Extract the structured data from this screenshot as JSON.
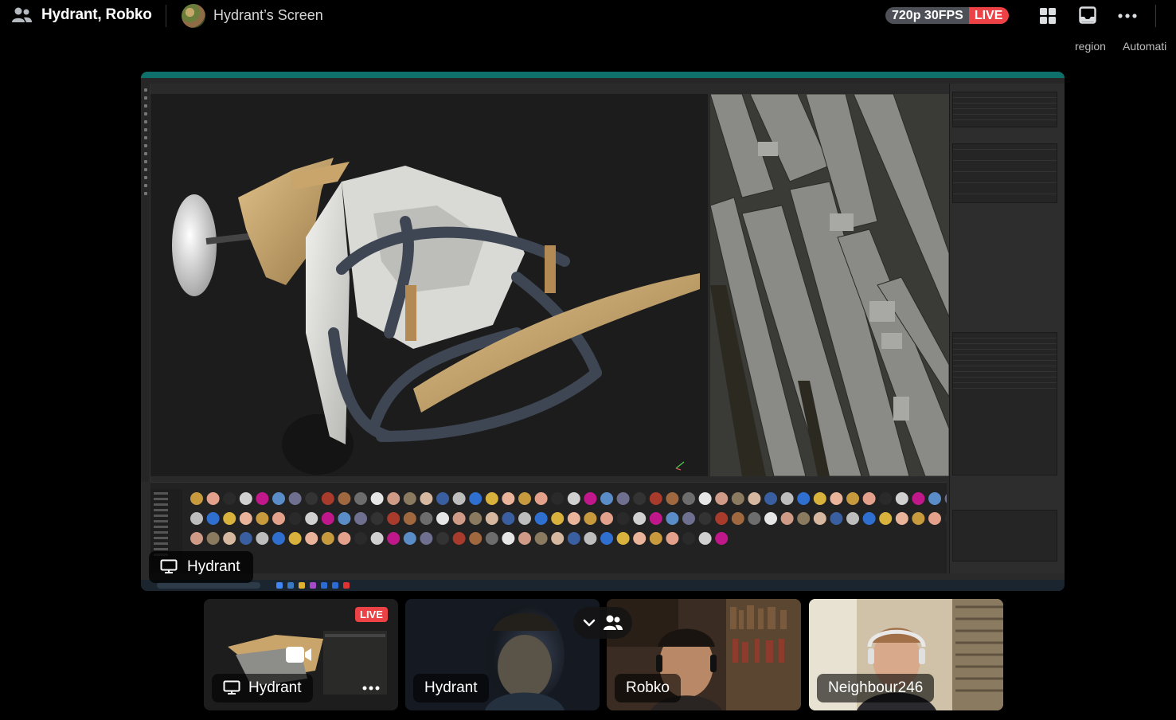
{
  "header": {
    "channel_title": "Hydrant, Robko",
    "screen_title": "Hydrant’s Screen",
    "stream_quality": "720p 30FPS",
    "live_label": "LIVE",
    "region_label": "region",
    "automation_label": "Automati"
  },
  "stream": {
    "presenter_label": "Hydrant"
  },
  "participants": [
    {
      "name": "Hydrant",
      "live_label": "LIVE",
      "type": "screen"
    },
    {
      "name": "Hydrant",
      "type": "camera"
    },
    {
      "name": "Robko",
      "type": "camera"
    },
    {
      "name": "Neighbour246",
      "type": "camera"
    }
  ],
  "colors": {
    "live": "#ed4245",
    "pill": "#4e5058",
    "app_titlebar": "#0f6f6a",
    "car_body": "#c9a46b"
  },
  "icons": {
    "users": "users-icon",
    "grid": "grid-layout-icon",
    "inbox": "inbox-icon",
    "more": "more-dots-icon",
    "monitor": "monitor-icon",
    "camera": "video-camera-icon",
    "chevron": "chevron-down-icon"
  }
}
